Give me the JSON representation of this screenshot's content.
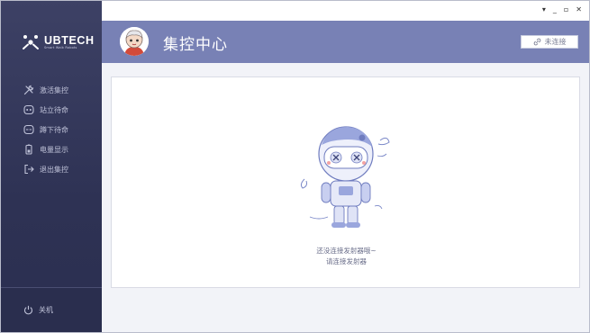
{
  "window": {
    "controls": [
      "▾",
      "_",
      "▫",
      "✕"
    ]
  },
  "sidebar": {
    "logo": {
      "brand": "UBTECH",
      "tagline": "Smart Walk Robots"
    },
    "items": [
      {
        "label": "激活集控",
        "icon": "wrench-icon"
      },
      {
        "label": "站立待命",
        "icon": "robot-face-icon"
      },
      {
        "label": "蹲下待命",
        "icon": "robot-face-icon"
      },
      {
        "label": "电量显示",
        "icon": "battery-icon"
      },
      {
        "label": "退出集控",
        "icon": "exit-icon"
      }
    ],
    "power_label": "关机"
  },
  "header": {
    "title": "集控中心",
    "status_label": "未连接",
    "status_icon": "link-icon"
  },
  "main": {
    "message_line1": "还没连接发射器哦~",
    "message_line2": "请连接发射器"
  },
  "colors": {
    "sidebar": "#33375a",
    "header": "#7881b5",
    "content_bg": "#f2f3f8",
    "robot_accent": "#9aa6dd"
  }
}
